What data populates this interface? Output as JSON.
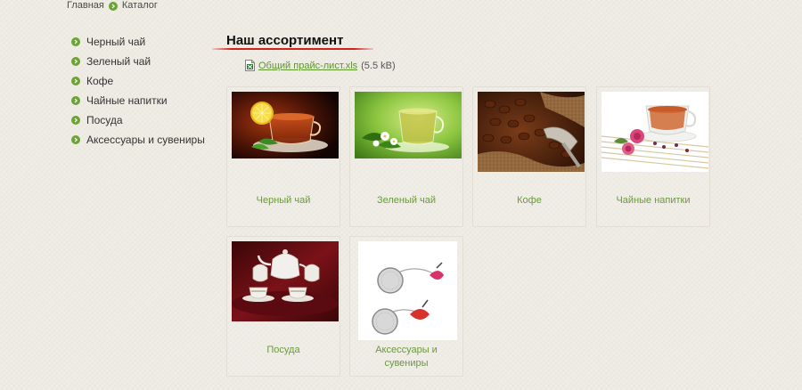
{
  "breadcrumb": {
    "home": "Главная",
    "current": "Каталог"
  },
  "sidebar": {
    "items": [
      {
        "label": "Черный чай"
      },
      {
        "label": "Зеленый чай"
      },
      {
        "label": "Кофе"
      },
      {
        "label": "Чайные напитки"
      },
      {
        "label": "Посуда"
      },
      {
        "label": "Аксессуары и сувениры"
      }
    ]
  },
  "main": {
    "title": "Наш ассортимент",
    "pricelist": {
      "link_text": "Общий прайс-лист.xls",
      "size": "(5.5 kB)"
    },
    "products": [
      {
        "label": "Черный чай",
        "image": "black-tea-cup"
      },
      {
        "label": "Зеленый чай",
        "image": "green-tea-cup"
      },
      {
        "label": "Кофе",
        "image": "coffee-beans"
      },
      {
        "label": "Чайные напитки",
        "image": "tea-drink-roses"
      },
      {
        "label": "Посуда",
        "image": "tea-set"
      },
      {
        "label": "Аксессуары и сувениры",
        "image": "tea-infusers"
      }
    ]
  },
  "colors": {
    "accent_green": "#6aa432",
    "link_green": "#5f9330",
    "label_green": "#6b9a3a",
    "underline_red": "#d1221e",
    "background": "#eeebe3"
  }
}
